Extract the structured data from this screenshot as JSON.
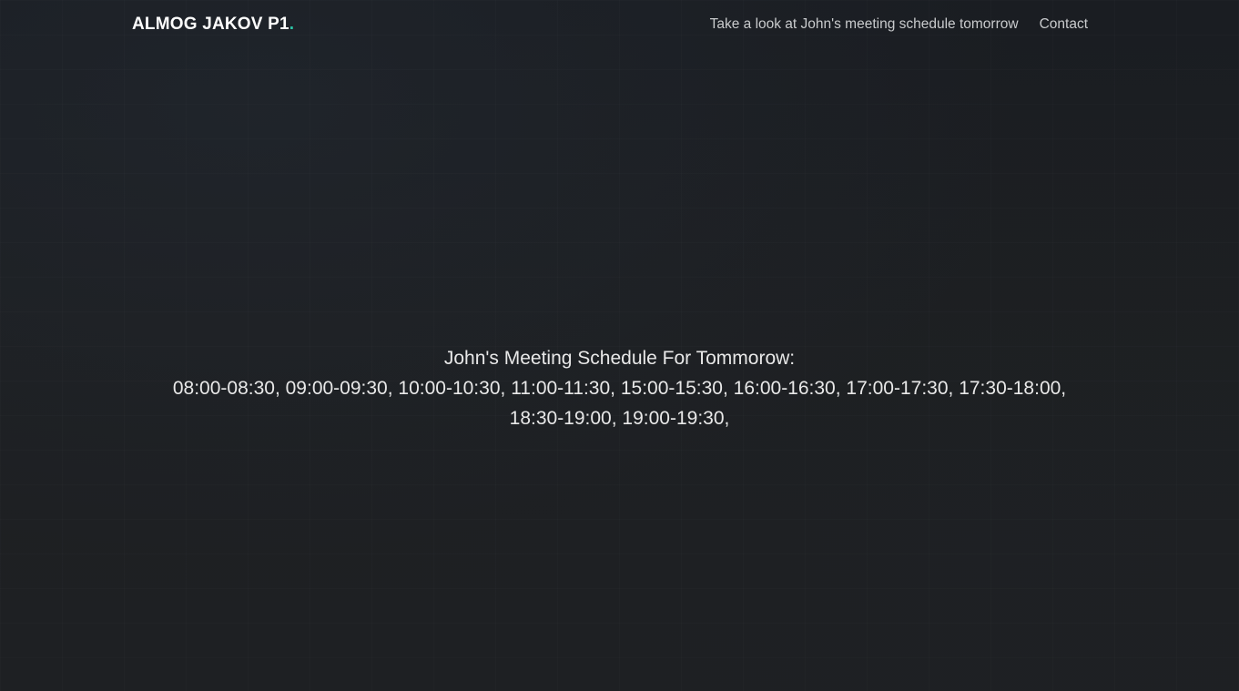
{
  "navbar": {
    "brand": "ALMOG JAKOV P1",
    "brand_suffix": ".",
    "links": [
      {
        "label": "Take a look at John's meeting schedule tomorrow"
      },
      {
        "label": "Contact"
      }
    ]
  },
  "schedule": {
    "title": "John's Meeting Schedule For Tommorow:",
    "slots": [
      "08:00-08:30,",
      "09:00-09:30,",
      "10:00-10:30,",
      "11:00-11:30,",
      "15:00-15:30,",
      "16:00-16:30,",
      "17:00-17:30,",
      "17:30-18:00,",
      "18:30-19:00,",
      "19:00-19:30,"
    ]
  },
  "colors": {
    "background": "#1c1f23",
    "accent": "#2bc4a6",
    "text": "#e8e8e8"
  }
}
